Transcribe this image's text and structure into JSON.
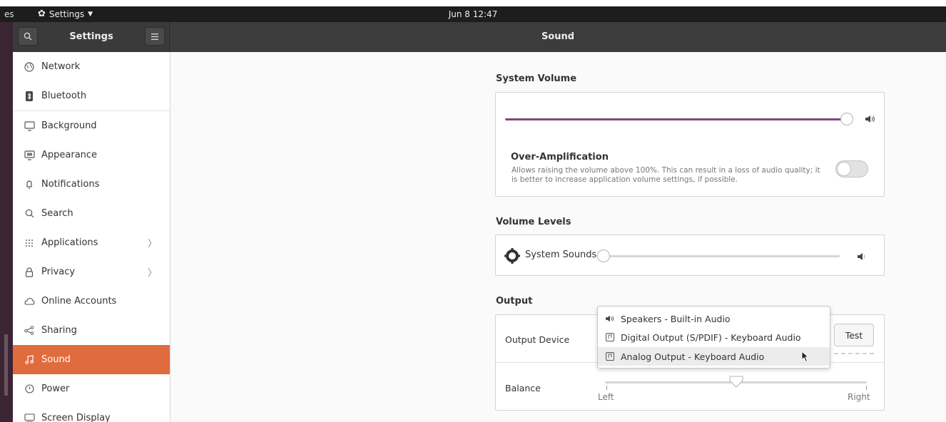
{
  "topbar": {
    "activities": "es",
    "app_menu": "Settings",
    "clock": "Jun 8  12:47"
  },
  "header": {
    "left_title": "Settings",
    "right_title": "Sound",
    "search_icon": "search-icon",
    "menu_icon": "hamburger-menu-icon"
  },
  "sidebar": {
    "items": [
      {
        "label": "Network",
        "icon": "globe-icon"
      },
      {
        "label": "Bluetooth",
        "icon": "bluetooth-icon"
      },
      {
        "label": "Background",
        "icon": "monitor-icon"
      },
      {
        "label": "Appearance",
        "icon": "appearance-icon"
      },
      {
        "label": "Notifications",
        "icon": "bell-icon"
      },
      {
        "label": "Search",
        "icon": "search-icon"
      },
      {
        "label": "Applications",
        "icon": "grid-icon"
      },
      {
        "label": "Privacy",
        "icon": "lock-icon"
      },
      {
        "label": "Online Accounts",
        "icon": "cloud-icon"
      },
      {
        "label": "Sharing",
        "icon": "share-icon"
      },
      {
        "label": "Sound",
        "icon": "music-note-icon"
      },
      {
        "label": "Power",
        "icon": "power-icon"
      },
      {
        "label": "Screen Display",
        "icon": "display-icon"
      }
    ],
    "active_index": 10,
    "accent": "#e06c3e"
  },
  "system_volume": {
    "title": "System Volume",
    "level": 1.0,
    "over_amp_title": "Over-Amplification",
    "over_amp_line1": "Allows raising the volume above 100%. This can result in a loss of audio quality; it",
    "over_amp_line2": "is better to increase application volume settings, if possible.",
    "over_amp_enabled": false
  },
  "volume_levels": {
    "title": "Volume Levels",
    "system_sounds_label": "System Sounds",
    "system_sounds_level": 0.0
  },
  "output": {
    "title": "Output",
    "device_label": "Output Device",
    "test_button": "Test",
    "balance_label": "Balance",
    "balance_left": "Left",
    "balance_right": "Right",
    "balance_value": 0.5,
    "options": [
      {
        "label": "Speakers - Built-in Audio",
        "icon": "speaker-icon"
      },
      {
        "label": "Digital Output (S/PDIF) - Keyboard Audio",
        "icon": "audio-card-icon"
      },
      {
        "label": "Analog Output - Keyboard Audio",
        "icon": "audio-card-icon"
      }
    ],
    "hovered_index": 2
  },
  "colors": {
    "slider_fill": "#7b4c7b",
    "headerbar": "#3c3c3c"
  }
}
